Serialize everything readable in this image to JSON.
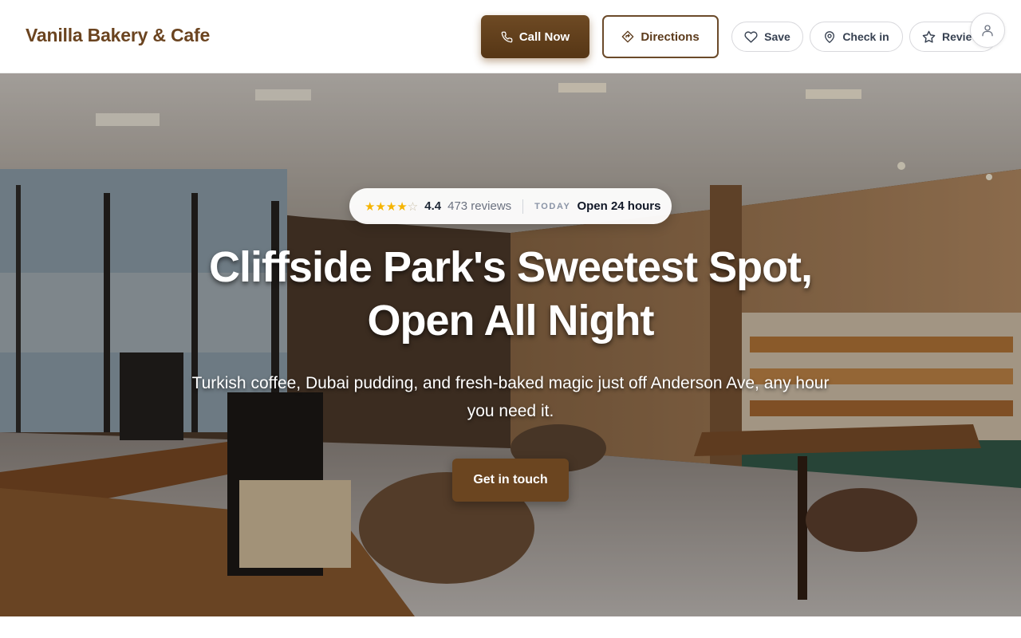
{
  "header": {
    "brand": "Vanilla Bakery & Cafe",
    "call_label": "Call Now",
    "directions_label": "Directions",
    "save_label": "Save",
    "checkin_label": "Check in",
    "review_label": "Review"
  },
  "hero": {
    "rating": {
      "stars": "★★★★",
      "half_star": "☆",
      "value": "4.4",
      "reviews": "473 reviews",
      "today_label": "TODAY",
      "hours": "Open 24 hours"
    },
    "title_line1": "Cliffside Park's Sweetest Spot,",
    "title_line2": "Open All Night",
    "subtitle": "Turkish coffee, Dubai pudding, and fresh-baked magic just off Anderson Ave, any hour you need it.",
    "cta_label": "Get in touch"
  },
  "colors": {
    "brand": "#6b4420",
    "primary_button": "#5c3b1c",
    "star": "#f5b400"
  }
}
